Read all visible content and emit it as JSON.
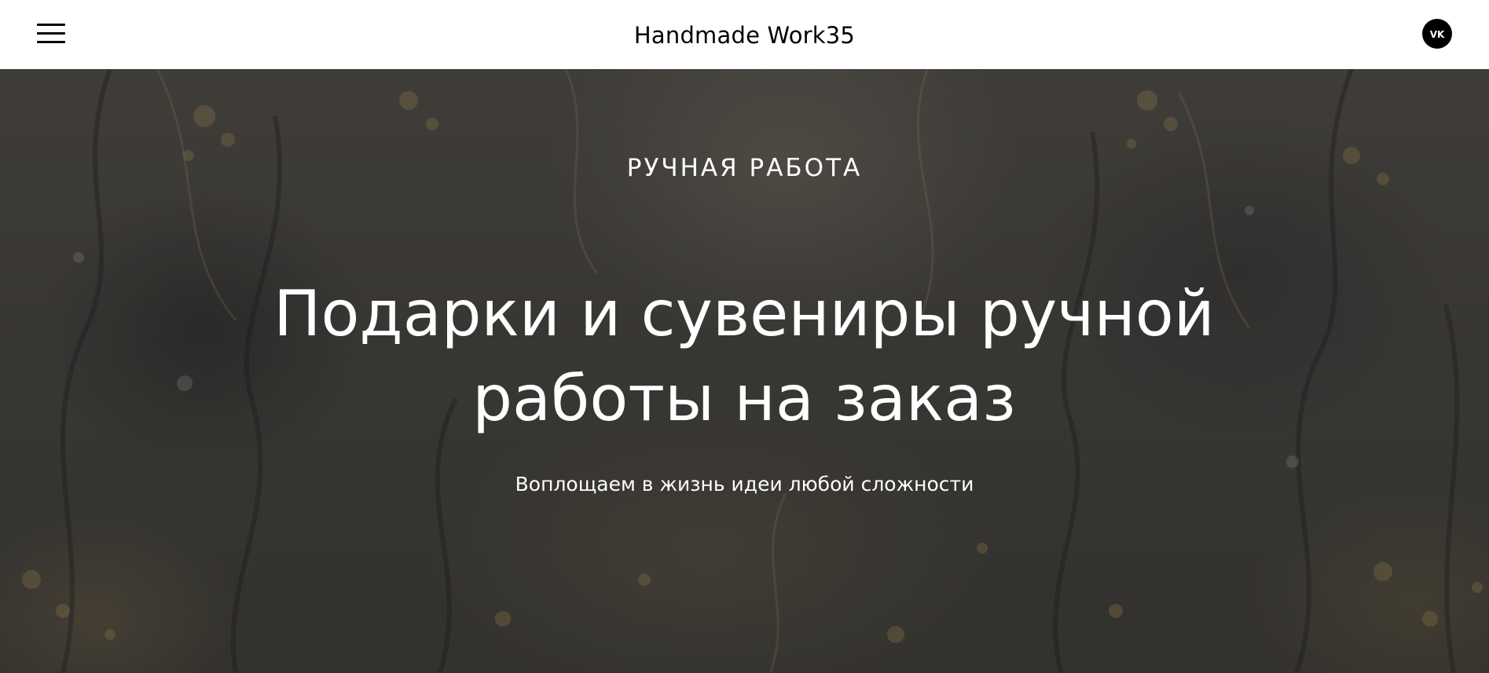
{
  "header": {
    "logo": "Handmade Work35",
    "menu_icon": "hamburger-menu-icon",
    "social_icon": "vk-icon",
    "social_label": "VK"
  },
  "hero": {
    "kicker": "РУЧНАЯ РАБОТА",
    "title": "Подарки и сувениры ручной работы на заказ",
    "subtitle": "Воплощаем в жизнь идеи любой сложности"
  },
  "colors": {
    "header_bg": "#ffffff",
    "text_dark": "#000000",
    "text_light": "#ffffff",
    "hero_overlay": "#45433f"
  }
}
